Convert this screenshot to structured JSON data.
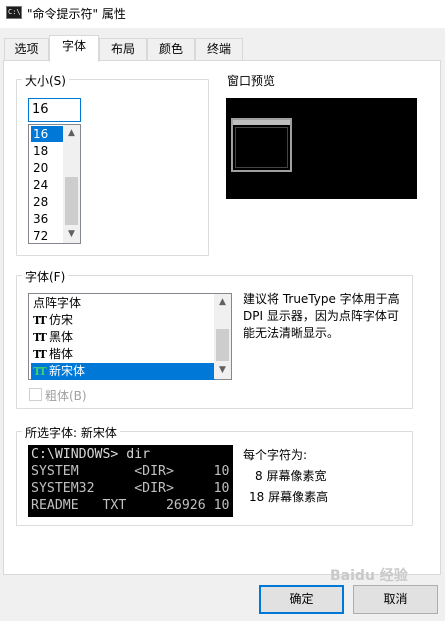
{
  "window": {
    "title": "\"命令提示符\" 属性",
    "icon_text": "C:\\."
  },
  "tabs": [
    {
      "label": "选项",
      "active": false
    },
    {
      "label": "字体",
      "active": true
    },
    {
      "label": "布局",
      "active": false
    },
    {
      "label": "颜色",
      "active": false
    },
    {
      "label": "终端",
      "active": false
    }
  ],
  "size_group": {
    "legend": "大小(S)",
    "input_value": "16",
    "items": [
      "16",
      "18",
      "20",
      "24",
      "28",
      "36",
      "72"
    ],
    "selected": "16"
  },
  "window_preview": {
    "label": "窗口预览"
  },
  "font_group": {
    "legend": "字体(F)",
    "items": [
      {
        "label": "点阵字体",
        "truetype": false
      },
      {
        "label": "仿宋",
        "truetype": true
      },
      {
        "label": "黑体",
        "truetype": true
      },
      {
        "label": "楷体",
        "truetype": true
      },
      {
        "label": "新宋体",
        "truetype": true
      }
    ],
    "selected": "新宋体",
    "truetype_glyph": "TT",
    "hint": "建议将 TrueType 字体用于高 DPI 显示器，因为点阵字体可能无法清晰显示。",
    "bold_label": "粗体(B)",
    "bold_checked": false
  },
  "selected_font": {
    "legend": "所选字体: 新宋体",
    "console_lines": [
      "C:\\WINDOWS> dir",
      "SYSTEM       <DIR>     10",
      "SYSTEM32     <DIR>     10",
      "README   TXT     26926 10"
    ],
    "char_info_title": "每个字符为:",
    "width_info": "8 屏幕像素宽",
    "height_info": "18 屏幕像素高"
  },
  "buttons": {
    "ok": "确定",
    "cancel": "取消"
  },
  "watermark": "Baidu 经验",
  "colors": {
    "accent": "#0078d7",
    "console_bg": "#000000",
    "console_fg": "#c0c0c0"
  }
}
